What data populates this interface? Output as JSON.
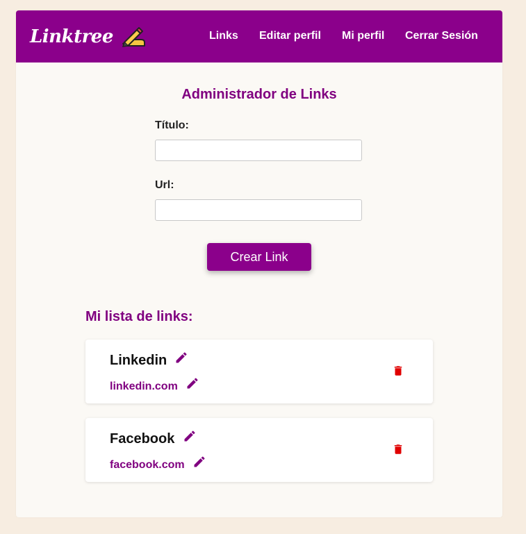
{
  "app": {
    "logo_text": "Linktree",
    "logo_icon": "writing-hand-icon"
  },
  "nav": {
    "links": [
      "Links",
      "Editar perfil",
      "Mi perfil",
      "Cerrar Sesión"
    ]
  },
  "form": {
    "title": "Administrador de Links",
    "title_label": "Título:",
    "title_value": "",
    "url_label": "Url:",
    "url_value": "",
    "submit_label": "Crear Link"
  },
  "list": {
    "heading": "Mi lista de links:",
    "items": [
      {
        "title": "Linkedin",
        "url": "linkedin.com"
      },
      {
        "title": "Facebook",
        "url": "facebook.com"
      }
    ]
  },
  "colors": {
    "brand": "#8b008b",
    "accent_text": "#800080",
    "danger": "#e00000",
    "page_bg": "#f7ede1"
  },
  "icons": [
    "writing-hand-icon",
    "pencil-icon",
    "trash-icon"
  ]
}
